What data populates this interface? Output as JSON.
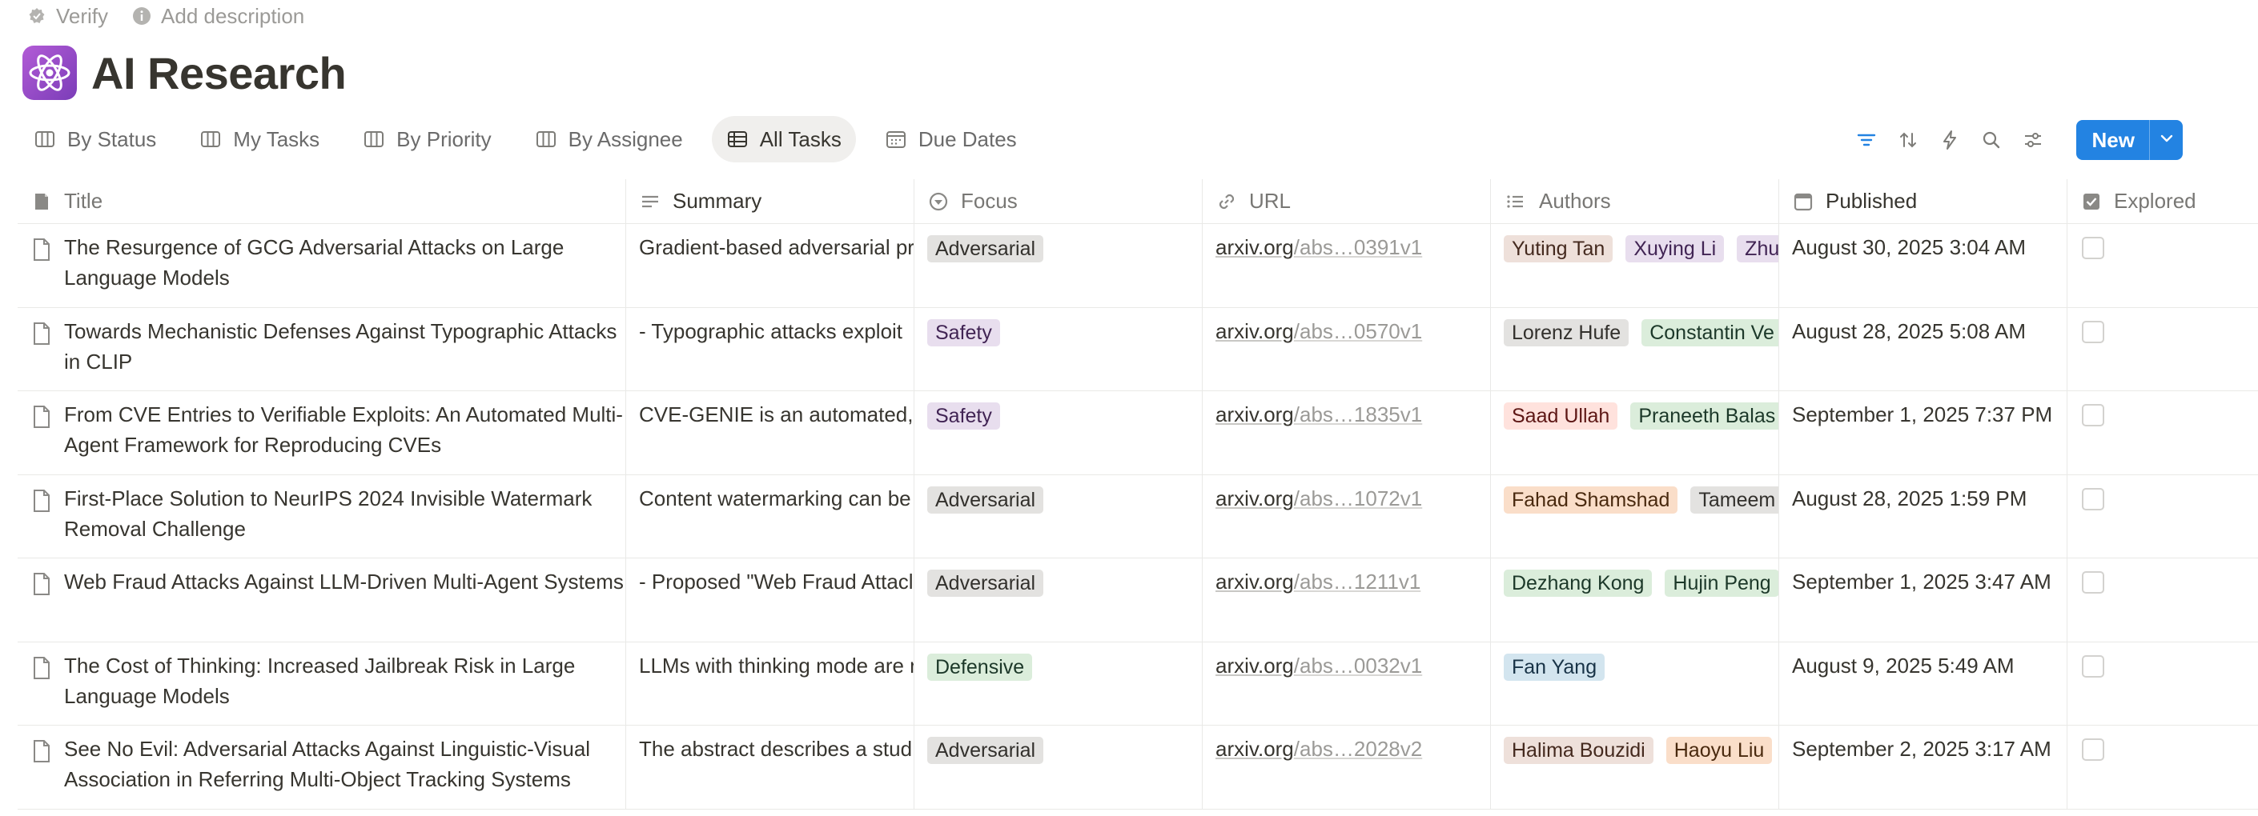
{
  "meta": {
    "verify": "Verify",
    "add_description": "Add description"
  },
  "page": {
    "title": "AI Research"
  },
  "views": [
    {
      "label": "By Status",
      "icon": "board-icon",
      "active": false
    },
    {
      "label": "My Tasks",
      "icon": "board-icon",
      "active": false
    },
    {
      "label": "By Priority",
      "icon": "board-icon",
      "active": false
    },
    {
      "label": "By Assignee",
      "icon": "board-icon",
      "active": false
    },
    {
      "label": "All Tasks",
      "icon": "table-icon",
      "active": true
    },
    {
      "label": "Due Dates",
      "icon": "calendar-icon",
      "active": false
    }
  ],
  "toolbar": {
    "new_label": "New",
    "accent": "#2383e2"
  },
  "columns": [
    "Title",
    "Summary",
    "Focus",
    "URL",
    "Authors",
    "Published",
    "Explored"
  ],
  "focus_colors": {
    "Adversarial": {
      "bg": "#e3e2e0",
      "fg": "#32302c"
    },
    "Safety": {
      "bg": "#e8deee",
      "fg": "#412454"
    },
    "Defensive": {
      "bg": "#dbeddb",
      "fg": "#1c3829"
    }
  },
  "author_colors": {
    "gray": {
      "bg": "#e3e2e0",
      "fg": "#32302c"
    },
    "brown": {
      "bg": "#eee0da",
      "fg": "#44291e"
    },
    "orange": {
      "bg": "#fadec9",
      "fg": "#49290e"
    },
    "green": {
      "bg": "#dbeddb",
      "fg": "#1c3829"
    },
    "blue": {
      "bg": "#d3e5ef",
      "fg": "#183347"
    },
    "purple": {
      "bg": "#e8deee",
      "fg": "#412454"
    },
    "red": {
      "bg": "#ffe2dd",
      "fg": "#5d1715"
    }
  },
  "rows": [
    {
      "title": "The Resurgence of GCG Adversarial Attacks on Large Language Models",
      "summary": "Gradient-based adversarial pr",
      "focus": "Adversarial",
      "url_host": "arxiv.org",
      "url_rest": "/abs…0391v1",
      "authors": [
        {
          "name": "Yuting Tan",
          "color": "brown"
        },
        {
          "name": "Xuying Li",
          "color": "purple"
        },
        {
          "name": "Zhu",
          "color": "purple"
        }
      ],
      "published": "August 30, 2025 3:04 AM",
      "explored": false
    },
    {
      "title": "Towards Mechanistic Defenses Against Typographic Attacks in CLIP",
      "summary": "- Typographic attacks exploit",
      "focus": "Safety",
      "url_host": "arxiv.org",
      "url_rest": "/abs…0570v1",
      "authors": [
        {
          "name": "Lorenz Hufe",
          "color": "gray"
        },
        {
          "name": "Constantin Ve",
          "color": "green"
        }
      ],
      "published": "August 28, 2025 5:08 AM",
      "explored": false
    },
    {
      "title": "From CVE Entries to Verifiable Exploits: An Automated Multi-Agent Framework for Reproducing CVEs",
      "summary": "CVE-GENIE is an automated, L",
      "focus": "Safety",
      "url_host": "arxiv.org",
      "url_rest": "/abs…1835v1",
      "authors": [
        {
          "name": "Saad Ullah",
          "color": "red"
        },
        {
          "name": "Praneeth Balas",
          "color": "green"
        }
      ],
      "published": "September 1, 2025 7:37 PM",
      "explored": false
    },
    {
      "title": "First-Place Solution to NeurIPS 2024 Invisible Watermark Removal Challenge",
      "summary": "Content watermarking can be",
      "focus": "Adversarial",
      "url_host": "arxiv.org",
      "url_rest": "/abs…1072v1",
      "authors": [
        {
          "name": "Fahad Shamshad",
          "color": "orange"
        },
        {
          "name": "Tameem",
          "color": "gray"
        }
      ],
      "published": "August 28, 2025 1:59 PM",
      "explored": false
    },
    {
      "title": "Web Fraud Attacks Against LLM-Driven Multi-Agent Systems",
      "summary": "- Proposed \"Web Fraud Attacl",
      "focus": "Adversarial",
      "url_host": "arxiv.org",
      "url_rest": "/abs…1211v1",
      "authors": [
        {
          "name": "Dezhang Kong",
          "color": "green"
        },
        {
          "name": "Hujin Peng",
          "color": "green"
        }
      ],
      "published": "September 1, 2025 3:47 AM",
      "explored": false
    },
    {
      "title": "The Cost of Thinking: Increased Jailbreak Risk in Large Language Models",
      "summary": "LLMs with thinking mode are r",
      "focus": "Defensive",
      "url_host": "arxiv.org",
      "url_rest": "/abs…0032v1",
      "authors": [
        {
          "name": "Fan Yang",
          "color": "blue"
        }
      ],
      "published": "August 9, 2025 5:49 AM",
      "explored": false
    },
    {
      "title": "See No Evil: Adversarial Attacks Against Linguistic-Visual Association in Referring Multi-Object Tracking Systems",
      "summary": "The abstract describes a stud",
      "focus": "Adversarial",
      "url_host": "arxiv.org",
      "url_rest": "/abs…2028v2",
      "authors": [
        {
          "name": "Halima Bouzidi",
          "color": "brown"
        },
        {
          "name": "Haoyu Liu",
          "color": "orange"
        }
      ],
      "published": "September 2, 2025 3:17 AM",
      "explored": false
    }
  ]
}
